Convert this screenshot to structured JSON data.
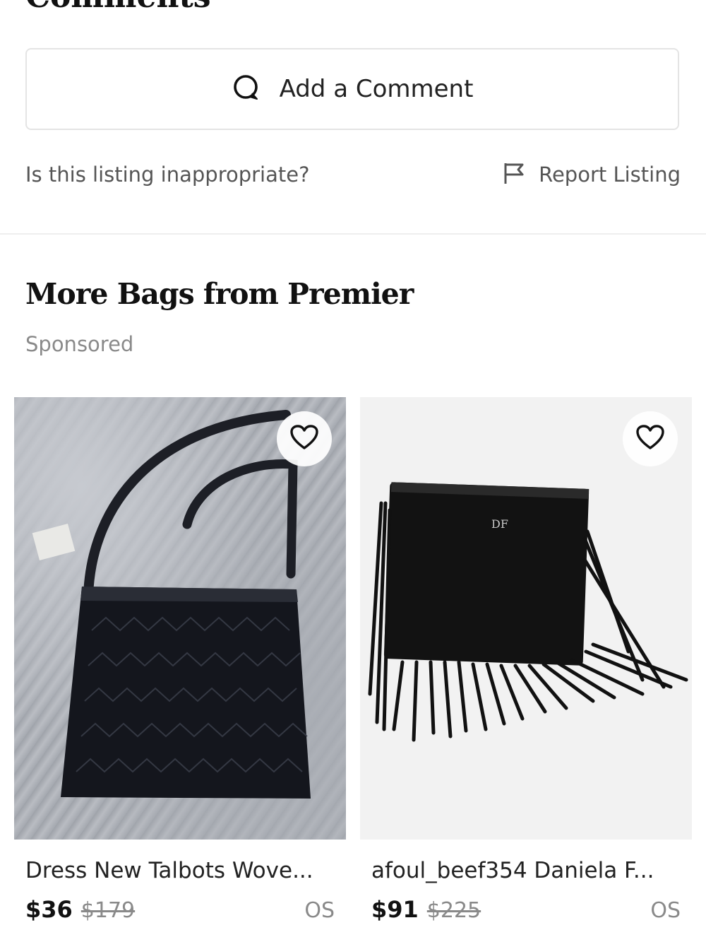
{
  "comments": {
    "heading": "Comments",
    "add_comment_label": "Add a Comment"
  },
  "report": {
    "question": "Is this listing inappropriate?",
    "link_label": "Report Listing"
  },
  "more_section": {
    "title": "More Bags from Premier",
    "sponsored_label": "Sponsored"
  },
  "listings": [
    {
      "title": "Dress New Talbots Wove...",
      "price": "$36",
      "original_price": "$179",
      "size": "OS",
      "image_icon": "woven-shoulder-bag-image"
    },
    {
      "title": "afoul_beef354 Daniela F...",
      "price": "$91",
      "original_price": "$225",
      "size": "OS",
      "image_icon": "fringe-clutch-image"
    }
  ],
  "icons": {
    "comment": "comment-bubble-icon",
    "report": "flag-icon",
    "like": "heart-icon"
  },
  "colors": {
    "text_primary": "#222222",
    "text_muted": "#8a8a8a",
    "border": "#e4e4e4"
  }
}
